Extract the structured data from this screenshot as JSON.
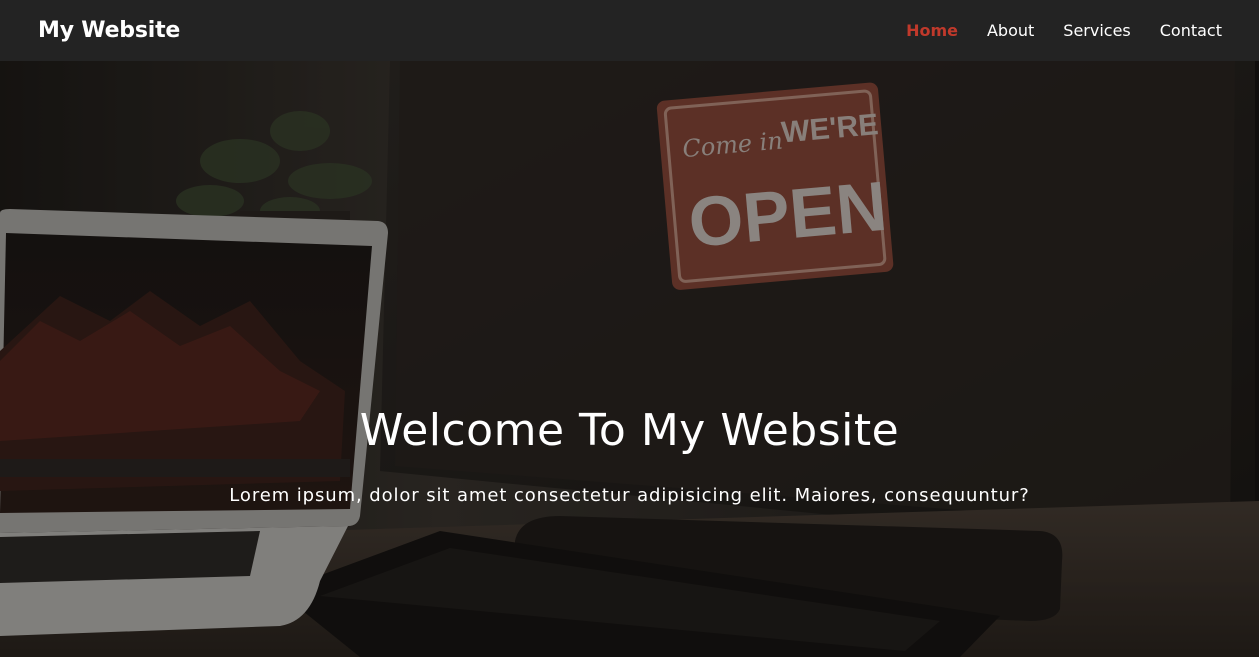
{
  "navbar": {
    "brand": "My Website",
    "links": [
      {
        "label": "Home",
        "active": true
      },
      {
        "label": "About",
        "active": false
      },
      {
        "label": "Services",
        "active": false
      },
      {
        "label": "Contact",
        "active": false
      }
    ]
  },
  "hero": {
    "title": "Welcome To My Website",
    "subtitle": "Lorem ipsum, dolor sit amet consectetur adipisicing elit. Maiores, consequuntur?",
    "sign_script": "Come in",
    "sign_top": "WE'RE",
    "sign_main": "OPEN"
  },
  "colors": {
    "navbar_bg": "#232323",
    "active_link": "#c0392b",
    "text": "#ffffff"
  }
}
